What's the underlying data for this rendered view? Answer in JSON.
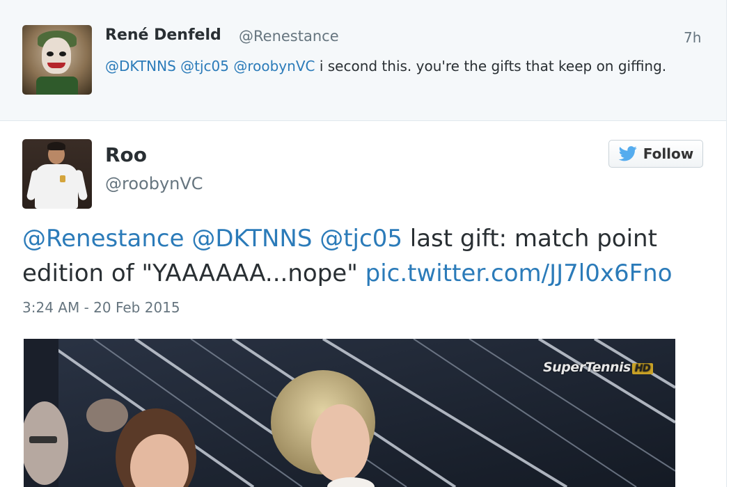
{
  "reply_tweet": {
    "display_name": "René Denfeld",
    "handle": "@Renestance",
    "time": "7h",
    "mentions": [
      "@DKTNNS",
      "@tjc05",
      "@roobynVC"
    ],
    "text": "i second this. you're the gifts that keep on giffing."
  },
  "main_tweet": {
    "display_name": "Roo",
    "handle": "@roobynVC",
    "follow_label": "Follow",
    "mentions": [
      "@Renestance",
      "@DKTNNS",
      "@tjc05"
    ],
    "text_line1": "last gift: match point",
    "text_line2": "edition of \"YAAAAAA...nope\"",
    "link": "pic.twitter.com/JJ7l0x6Fno",
    "timestamp": "3:24 AM - 20 Feb 2015"
  },
  "media": {
    "watermark": "SuperTennis",
    "watermark_badge": "HD"
  },
  "colors": {
    "link": "#2b7bb9",
    "twitter_blue": "#55acee",
    "muted": "#66757f",
    "text": "#292f33"
  },
  "icons": {
    "follow_icon": "twitter-bird-icon"
  }
}
